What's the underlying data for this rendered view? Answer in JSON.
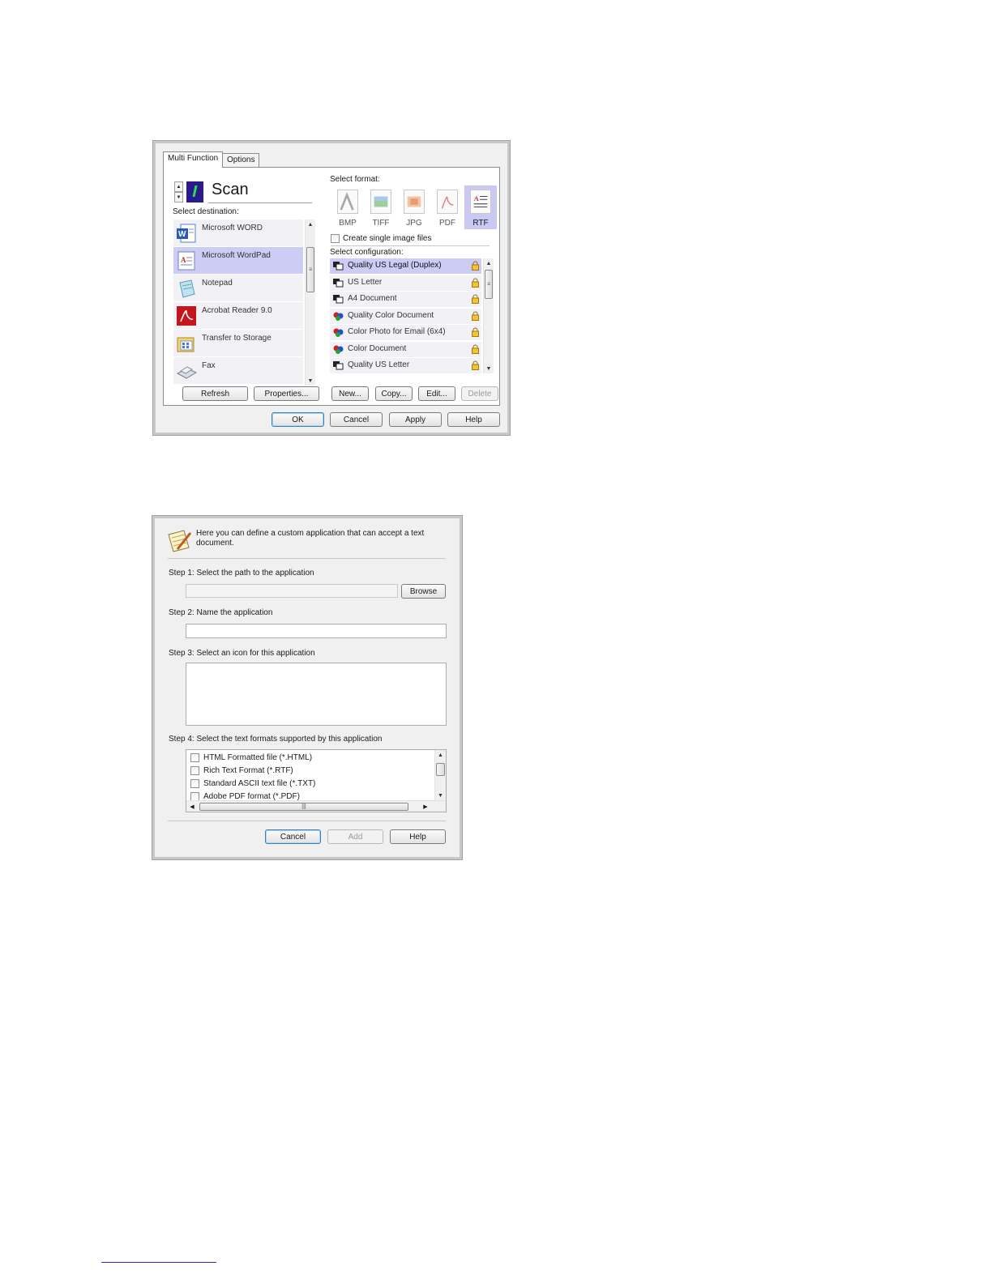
{
  "dialog1": {
    "tabs": [
      "Multi Function",
      "Options"
    ],
    "scan_title": "Scan",
    "select_destination_label": "Select destination:",
    "destinations": [
      {
        "label": "Microsoft WORD",
        "icon": "word-icon",
        "selected": false
      },
      {
        "label": "Microsoft WordPad",
        "icon": "wordpad-icon",
        "selected": true
      },
      {
        "label": "Notepad",
        "icon": "notepad-icon",
        "selected": false
      },
      {
        "label": "Acrobat Reader 9.0",
        "icon": "acrobat-icon",
        "selected": false
      },
      {
        "label": "Transfer to Storage",
        "icon": "storage-icon",
        "selected": false
      },
      {
        "label": "Fax",
        "icon": "fax-icon",
        "selected": false
      }
    ],
    "select_format_label": "Select format:",
    "formats": [
      {
        "label": "BMP",
        "selected": false
      },
      {
        "label": "TIFF",
        "selected": false
      },
      {
        "label": "JPG",
        "selected": false
      },
      {
        "label": "PDF",
        "selected": false
      },
      {
        "label": "RTF",
        "selected": true
      }
    ],
    "single_image_label": "Create single image files",
    "select_configuration_label": "Select configuration:",
    "configurations": [
      {
        "label": "Quality US Legal (Duplex)",
        "icon": "bw-config-icon",
        "selected": true
      },
      {
        "label": "US Letter",
        "icon": "bw-config-icon",
        "selected": false
      },
      {
        "label": "A4 Document",
        "icon": "bw-config-icon",
        "selected": false
      },
      {
        "label": "Quality Color Document",
        "icon": "color-config-icon",
        "selected": false
      },
      {
        "label": "Color Photo for Email (6x4)",
        "icon": "color-config-icon",
        "selected": false
      },
      {
        "label": "Color Document",
        "icon": "color-config-icon",
        "selected": false
      },
      {
        "label": "Quality US Letter",
        "icon": "bw-config-icon",
        "selected": false
      }
    ],
    "buttons": {
      "refresh": "Refresh",
      "properties": "Properties...",
      "new": "New...",
      "copy": "Copy...",
      "edit": "Edit...",
      "delete": "Delete",
      "ok": "OK",
      "cancel": "Cancel",
      "apply": "Apply",
      "help": "Help"
    }
  },
  "dialog2": {
    "intro": [
      "Here you can define a custom application that can accept a text",
      "document."
    ],
    "step1": "Step 1: Select the path to the application",
    "browse": "Browse",
    "step2": "Step 2: Name the application",
    "step3": "Step 3: Select an icon for this application",
    "step4": "Step 4: Select the text formats supported by this application",
    "formats": [
      "HTML Formatted file (*.HTML)",
      "Rich Text Format (*.RTF)",
      "Standard ASCII text file (*.TXT)",
      "Adobe PDF format (*.PDF)"
    ],
    "buttons": {
      "cancel": "Cancel",
      "add": "Add",
      "help": "Help"
    }
  }
}
